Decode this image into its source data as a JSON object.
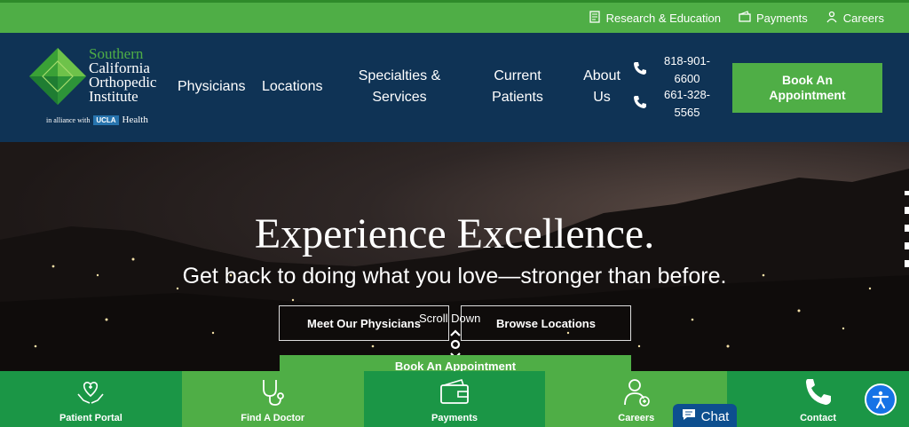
{
  "topbar": {
    "links": [
      {
        "label": "Research & Education",
        "icon": "document-icon"
      },
      {
        "label": "Payments",
        "icon": "wallet-icon"
      },
      {
        "label": "Careers",
        "icon": "people-icon"
      }
    ]
  },
  "logo": {
    "lines": [
      "Southern",
      "California",
      "Orthopedic",
      "Institute"
    ],
    "alliance_prefix": "in alliance with",
    "ucla": "UCLA",
    "health": "Health"
  },
  "nav": {
    "physicians": "Physicians",
    "locations": "Locations",
    "specialties_line1": "Specialties &",
    "specialties_line2": "Services",
    "current_line1": "Current",
    "current_line2": "Patients",
    "about_line1": "About",
    "about_line2": "Us"
  },
  "phones": {
    "phone1_line1": "818-901-",
    "phone1_line2": "6600",
    "phone2_line1": "661-328-",
    "phone2_line2": "5565"
  },
  "book": {
    "line1": "Book An",
    "line2": "Appointment"
  },
  "hero": {
    "title": "Experience Excellence.",
    "subtitle": "Get back to doing what you love—stronger than before.",
    "meet_physicians": "Meet Our Physicians",
    "scroll_down": "Scroll Down",
    "browse_locations": "Browse Locations",
    "book_partial": "Book An Appointment"
  },
  "bottombar": {
    "items": [
      {
        "label": "Patient Portal",
        "icon": "heart-hands-icon",
        "color": "#1b9646"
      },
      {
        "label": "Find A Doctor",
        "icon": "stethoscope-icon",
        "color": "#4fae46"
      },
      {
        "label": "Payments",
        "icon": "wallet-icon",
        "color": "#1b9646"
      },
      {
        "label": "Careers",
        "icon": "doctor-icon",
        "color": "#4fae46"
      },
      {
        "label": "Contact",
        "icon": "phone-icon",
        "color": "#1b9646"
      }
    ]
  },
  "chat": {
    "label": "Chat"
  },
  "colors": {
    "brand_green": "#4fae46",
    "dark_green": "#1b9646",
    "navy": "#0f3355",
    "chat_blue": "#0d4f8f",
    "accessibility_blue": "#1673e6"
  }
}
